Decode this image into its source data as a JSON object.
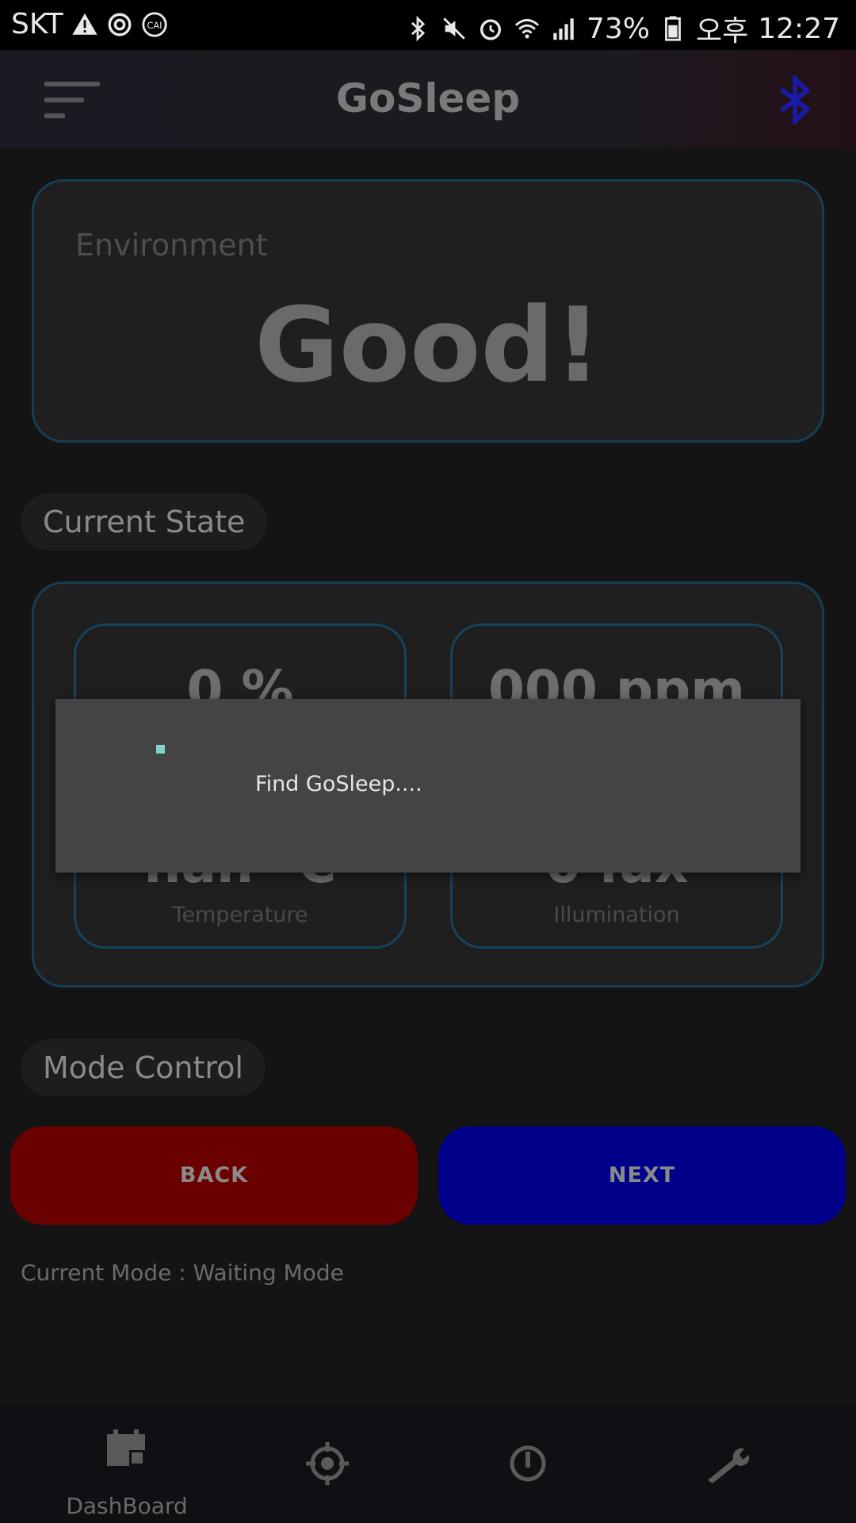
{
  "status_bar": {
    "carrier": "SKT",
    "battery_percent": "73%",
    "ampm": "오후",
    "time": "12:27",
    "icons_left": [
      "warning-icon",
      "sync-icon",
      "cai-icon"
    ],
    "icons_right": [
      "bluetooth-icon",
      "mute-icon",
      "alarm-icon",
      "wifi-icon",
      "signal-icon",
      "battery-icon"
    ]
  },
  "app_bar": {
    "title": "GoSleep",
    "menu_icon": "sort-menu-icon",
    "bluetooth_icon": "bluetooth-icon",
    "bluetooth_color": "#1a1aa8"
  },
  "environment": {
    "label": "Environment",
    "value": "Good!"
  },
  "current_state": {
    "heading": "Current State",
    "tiles": [
      {
        "value": "0 %",
        "label": ""
      },
      {
        "value": "000 ppm",
        "label": ""
      },
      {
        "value": "nan °C",
        "label": "Temperature"
      },
      {
        "value": "0 lux",
        "label": "Illumination"
      }
    ]
  },
  "mode_control": {
    "heading": "Mode Control",
    "back_label": "BACK",
    "next_label": "NEXT",
    "back_color": "#6b0000",
    "next_color": "#00008a",
    "current_mode_text": "Current Mode : Waiting Mode"
  },
  "bottom_nav": {
    "items": [
      {
        "icon": "dashboard-icon",
        "label": "DashBoard"
      },
      {
        "icon": "target-icon",
        "label": ""
      },
      {
        "icon": "power-icon",
        "label": ""
      },
      {
        "icon": "wrench-icon",
        "label": ""
      }
    ]
  },
  "dialog": {
    "message": "Find GoSleep....",
    "spinner_color": "#7fd4c9"
  }
}
